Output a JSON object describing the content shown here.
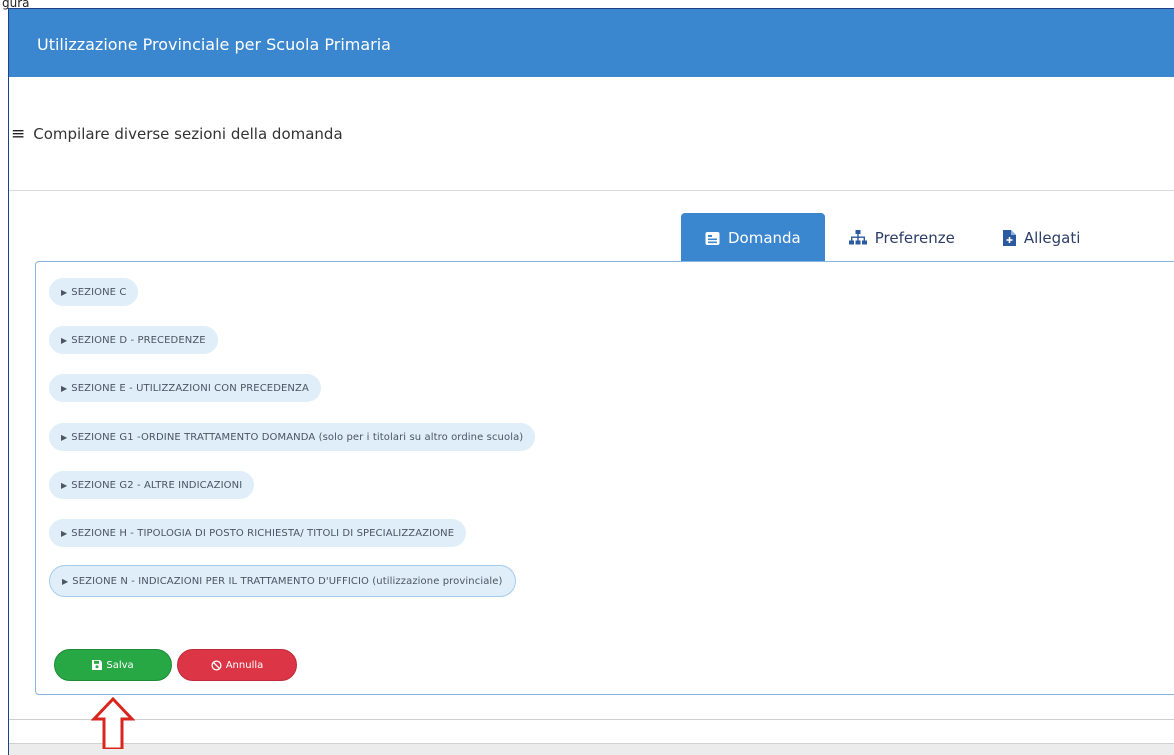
{
  "figure_label": "gura",
  "header": {
    "title": "Utilizzazione Provinciale per Scuola Primaria"
  },
  "subheader": {
    "text": "Compilare diverse sezioni della domanda",
    "icon": "menu-lines-icon"
  },
  "tabs": [
    {
      "label": "Domanda",
      "icon": "id-card-icon",
      "active": true
    },
    {
      "label": "Preferenze",
      "icon": "sitemap-icon",
      "active": false
    },
    {
      "label": "Allegati",
      "icon": "file-plus-icon",
      "active": false
    }
  ],
  "sections": [
    {
      "label": "SEZIONE C"
    },
    {
      "label": "SEZIONE D - PRECEDENZE"
    },
    {
      "label": "SEZIONE E - UTILIZZAZIONI CON PRECEDENZA"
    },
    {
      "label": "SEZIONE G1 -ORDINE TRATTAMENTO DOMANDA (solo per i titolari su altro ordine scuola)"
    },
    {
      "label": "SEZIONE G2 - ALTRE INDICAZIONI"
    },
    {
      "label": "SEZIONE H - TIPOLOGIA DI POSTO RICHIESTA/ TITOLI DI SPECIALIZZAZIONE"
    },
    {
      "label": "SEZIONE N - INDICAZIONI PER IL TRATTAMENTO D'UFFICIO (utilizzazione provinciale)"
    }
  ],
  "actions": {
    "save_label": "Salva",
    "cancel_label": "Annulla"
  },
  "colors": {
    "header_blue": "#3a86cf",
    "save_green": "#28a745",
    "cancel_red": "#dc3545",
    "callout_red": "#d9261c"
  }
}
